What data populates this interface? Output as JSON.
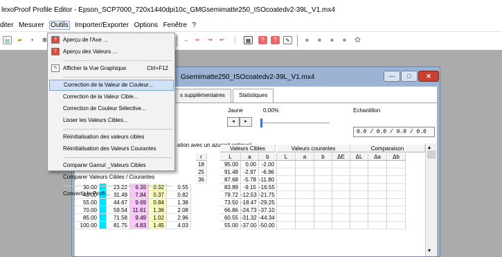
{
  "app": {
    "title": "lexoProof Profile Editor - Epson_SCP7000_720x1440dpi10c_GMGsemimatte250_ISOcoatedv2-39L_V1.mx4"
  },
  "menubar": {
    "items": [
      "diter",
      "Mesurer",
      "Outils",
      "Importer/Exporter",
      "Options",
      "Fenêtre",
      "?"
    ],
    "active": "Outils"
  },
  "toolbar": {
    "icons": [
      "open-icon",
      "folder-icon",
      "save-icon",
      "grid-icon",
      "arrow-right-icon",
      "arrow-right-alt-icon",
      "arrow-curve-icon",
      "arrow-curve-alt-icon",
      "curve-icon",
      "grid-view-icon",
      "question-box-icon",
      "question-box-alt-icon",
      "edit-box-icon",
      "dot-icon",
      "dot-icon",
      "dot-icon",
      "dot-icon",
      "flower-icon"
    ]
  },
  "colors": {
    "mdi_bg": "#ababab",
    "window_frame": "#9cb3d4",
    "highlight": "#d1e2f8",
    "cyan_cell": "#00e3ff",
    "magenta_cell": "#fac6fa",
    "yellow_cell": "#fcfcbf",
    "close_button": "#c8402f"
  },
  "tools_menu": {
    "items": [
      {
        "label": "Aperçu de l'Axe ...",
        "icon": "preview-axis-icon"
      },
      {
        "label": "Aperçu des Valeurs ...",
        "icon": "preview-values-icon"
      },
      {
        "separator": true
      },
      {
        "label": "Afficher la Vue Graphique",
        "shortcut": "Ctrl+F12",
        "icon": "graph-view-icon"
      },
      {
        "separator": true
      },
      {
        "label": "Correction de la Valeur de Couleur...",
        "highlighted": true
      },
      {
        "label": "Correction de la Valeur Cible..."
      },
      {
        "label": "Correction de Couleur Sélective..."
      },
      {
        "label": "Lisser les Valeurs Cibles..."
      },
      {
        "separator": true
      },
      {
        "label": "Réinitialisation des valeurs cibles"
      },
      {
        "label": "Réinitialisation des Valeurs Courantes"
      },
      {
        "separator": true
      },
      {
        "label": "Comparer Gamut _Valeurs Cibles"
      },
      {
        "label": "Comparer Valeurs Cibles / Courantes"
      },
      {
        "separator": true
      },
      {
        "label": "Convertir le Profil..."
      }
    ]
  },
  "doc_window": {
    "title": "Gsemimatte250_ISOcoatedv2-39L_V1.mx4",
    "minimize": "—",
    "maximize": "□",
    "close": "✕",
    "tabs": [
      "s supplémentaires",
      "Statistiques"
    ],
    "channel_label": "Jaune",
    "channel_value": "0.00%",
    "echantillon_label": "Echantillon",
    "echantillon_value": "0.0 / 0.0 / 0.0 / 0.0",
    "slider_left": "◂",
    "slider_right": "▸",
    "note": "ation avec un azurant optique)",
    "group_headers": [
      "Valeurs Cibles",
      "Valeurs courantes",
      "Comparaison"
    ],
    "col_headers": [
      "r",
      "L",
      "a",
      "b",
      "L",
      "a",
      "b",
      "ΔE",
      "ΔL",
      "Δa",
      "Δb"
    ],
    "scroll_up": "▴",
    "scroll_down": "▾"
  },
  "table": {
    "rows_top": [
      [
        "18",
        "95.00",
        "0.00",
        "-2.00"
      ],
      [
        "25",
        "91.48",
        "-2.97",
        "-6.96"
      ],
      [
        "36",
        "87.68",
        "-5.78",
        "-11.80"
      ]
    ],
    "rows_full": [
      [
        "30.00",
        "",
        "23.22",
        "6.35",
        "0.32",
        "0.55",
        "83.89",
        "-9.15",
        "-16.55"
      ],
      [
        "40.00",
        "",
        "31.49",
        "7.84",
        "0.37",
        "0.82",
        "79.72",
        "-12.53",
        "-21.75"
      ],
      [
        "55.00",
        "",
        "44.67",
        "9.69",
        "0.84",
        "1.38",
        "73.50",
        "-18.47",
        "-29.25"
      ],
      [
        "70.00",
        "",
        "59.54",
        "11.61",
        "1.36",
        "2.08",
        "66.86",
        "-24.73",
        "-37.10"
      ],
      [
        "85.00",
        "",
        "71.58",
        "9.49",
        "1.02",
        "2.96",
        "60.55",
        "-31.32",
        "-44.34"
      ],
      [
        "100.00",
        "",
        "81.75",
        "4.83",
        "1.45",
        "4.03",
        "55.00",
        "-37.00",
        "-50.00"
      ]
    ]
  }
}
